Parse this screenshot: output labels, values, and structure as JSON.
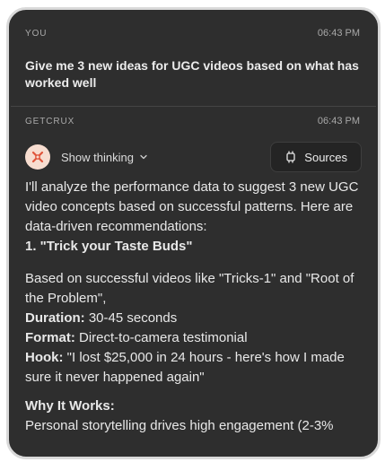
{
  "user_message": {
    "sender": "YOU",
    "time": "06:43 PM",
    "text": "Give me 3 new ideas for UGC videos based on what has worked well"
  },
  "assistant_message": {
    "sender": "GETCRUX",
    "time": "06:43 PM",
    "avatar_icon": "crux-logo-icon",
    "show_thinking_label": "Show thinking",
    "sources_label": "Sources",
    "intro": "I'll analyze the performance data to suggest 3 new UGC video concepts based on successful patterns. Here are data-driven recommendations:",
    "idea_heading": "1. \"Trick your Taste Buds\"",
    "based_on": "Based on successful videos like \"Tricks-1\" and \"Root of the Problem\",",
    "duration_label": "Duration:",
    "duration_value": " 30-45 seconds",
    "format_label": "Format:",
    "format_value": " Direct-to-camera testimonial",
    "hook_label": "Hook:",
    "hook_value": " \"I lost $25,000 in 24 hours - here's how I made sure it never happened again\"",
    "why_label": "Why It Works:",
    "why_text": "Personal storytelling drives high engagement (2-3%"
  },
  "colors": {
    "panel_bg": "#2e2e2e",
    "avatar_bg": "#f7ddd0",
    "avatar_accent": "#e0553b"
  }
}
